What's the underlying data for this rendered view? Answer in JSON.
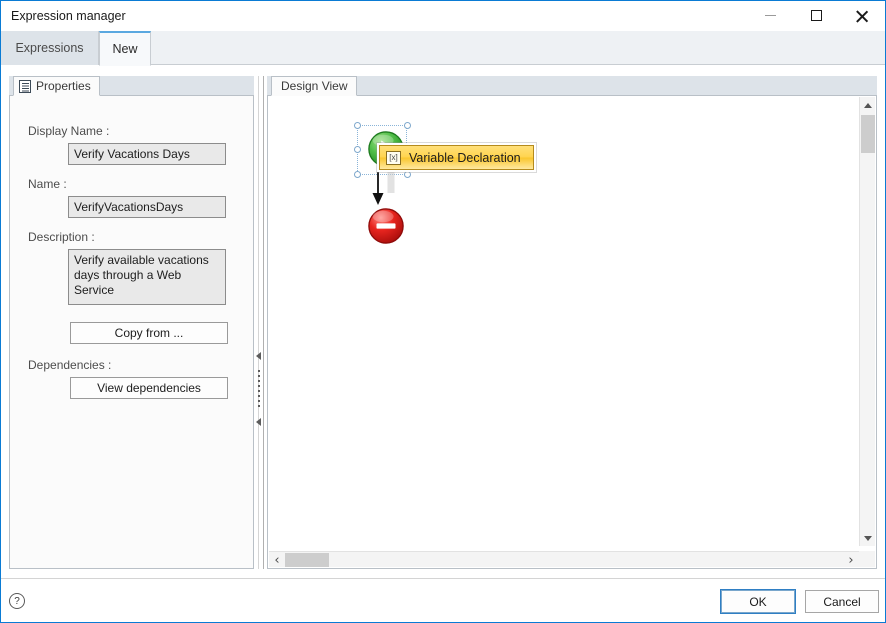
{
  "window": {
    "title": "Expression manager",
    "controls": {
      "minimize": "minimize-button",
      "maximize": "maximize-button",
      "close": "close-button"
    }
  },
  "tabs": [
    {
      "label": "Expressions",
      "active": false
    },
    {
      "label": "New",
      "active": true
    }
  ],
  "properties_panel": {
    "tab_label": "Properties",
    "tab_icon": "document-properties-icon",
    "fields": {
      "display_name_label": "Display Name :",
      "display_name_value": "Verify Vacations Days",
      "name_label": "Name :",
      "name_value": "VerifyVacationsDays",
      "description_label": "Description :",
      "description_value": "Verify available vacations days through a Web Service",
      "dependencies_label": "Dependencies :"
    },
    "buttons": {
      "copy_from": "Copy from ...",
      "view_dependencies": "View dependencies"
    }
  },
  "design_panel": {
    "tab_label": "Design View",
    "diagram": {
      "start_node": {
        "name": "start-node",
        "shape": "circle",
        "color": "#3fb34f",
        "glyph": "play"
      },
      "end_node": {
        "name": "end-node",
        "shape": "circle",
        "color": "#e01b1b",
        "glyph": "stop-bar"
      },
      "tooltip": {
        "label": "Variable Declaration",
        "icon": "[x]",
        "bg_color": "#ffd44f",
        "border_color": "#b58b1d"
      },
      "connector": {
        "from": "start-node",
        "to": "end-node",
        "style": "arrow-down"
      }
    },
    "scrollbars": {
      "vertical_up": "scroll-up-arrow",
      "vertical_down": "scroll-down-arrow",
      "horizontal_left": "‹",
      "horizontal_right": "›"
    }
  },
  "footer": {
    "help_glyph": "?",
    "ok_label": "OK",
    "cancel_label": "Cancel"
  },
  "colors": {
    "accent": "#0a7bd4",
    "tab_active_bg": "#f7f9fb",
    "tab_inactive_bg": "#dde3e9",
    "panel_bg": "#fbfbfb",
    "input_bg": "#e9e9e9"
  }
}
